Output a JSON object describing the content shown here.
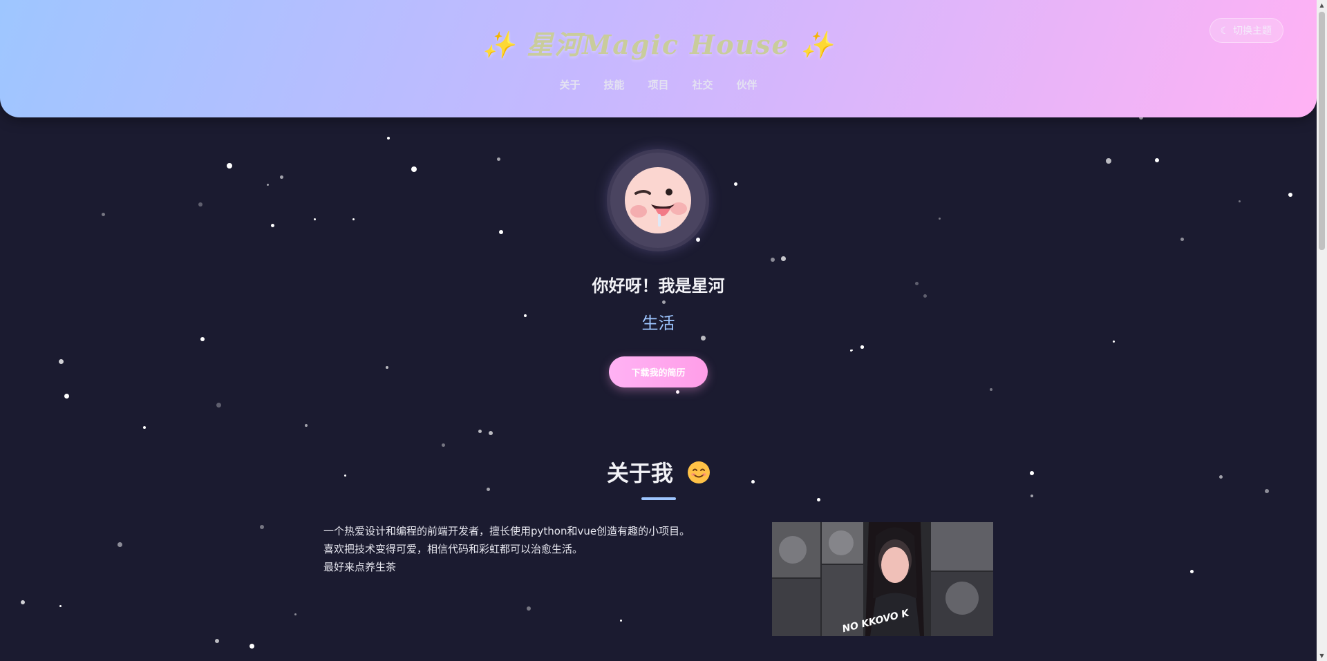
{
  "header": {
    "title": "✨ 星河Magic House ✨",
    "nav": [
      "关于",
      "技能",
      "项目",
      "社交",
      "伙伴"
    ],
    "theme_toggle": {
      "icon": "moon-icon",
      "label": "切换主题"
    }
  },
  "hero": {
    "avatar_icon": "cartoon-face-avatar",
    "name": "你好呀！我是星河",
    "role": "生活",
    "resume_button": "下载我的简历"
  },
  "about": {
    "title": "关于我",
    "title_icon": "smile-emoji-icon",
    "paragraphs": [
      "一个热爱设计和编程的前端开发者，擅长使用python和vue创造有趣的小项目。",
      "喜欢把技术变得可爱，相信代码和彩虹都可以治愈生活。",
      "最好来点养生茶"
    ],
    "image_caption": "NO KKOVO K"
  },
  "colors": {
    "background": "#1b1b30",
    "header_gradient_start": "#9ec6ff",
    "header_gradient_end": "#ffb2f4",
    "accent_blue": "#9ec6ff",
    "accent_pink": "#ffb2f4"
  }
}
